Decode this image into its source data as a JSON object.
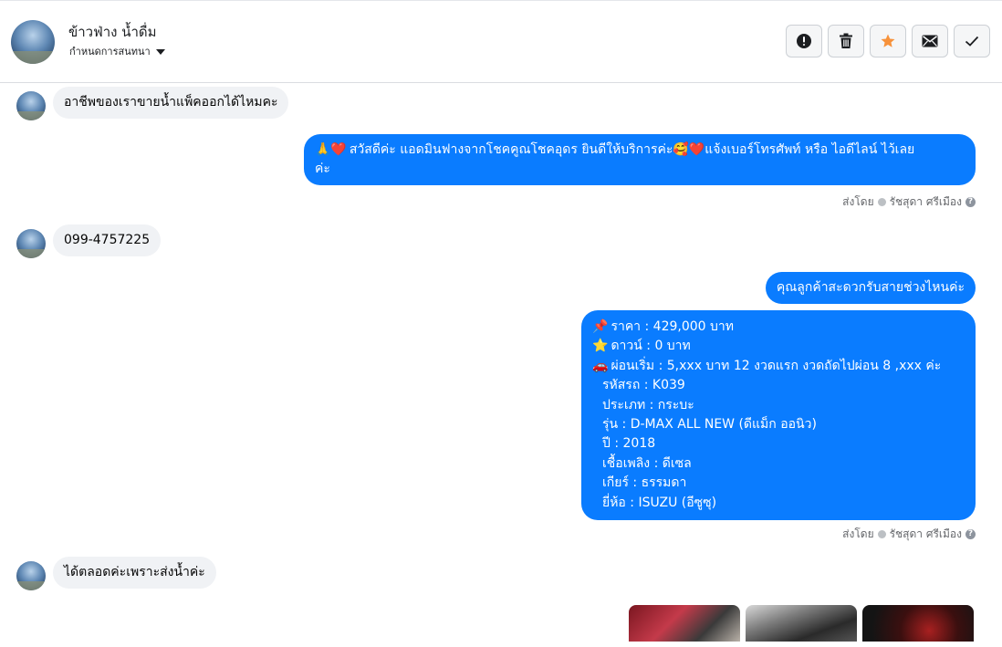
{
  "header": {
    "contact_name": "ข้าวฟ่าง น้ำดื่ม",
    "assign_label": "กำหนดการสนทนา"
  },
  "actions": [
    {
      "name": "spam-button",
      "icon": "alert-circle-icon"
    },
    {
      "name": "delete-button",
      "icon": "trash-icon"
    },
    {
      "name": "star-button",
      "icon": "star-icon",
      "color": "#f7923b"
    },
    {
      "name": "mark-unread-button",
      "icon": "envelope-icon"
    },
    {
      "name": "mark-done-button",
      "icon": "checkmark-icon"
    }
  ],
  "messages": {
    "m1": "อาชีพของเราขายน้ำแพ็คออกได้ไหมคะ",
    "m2_emoji": "🙏❤️",
    "m2_line1": "สวัสดีค่ะ แอดมินฟางจากโชคคูณโชคอุดร ยินดีให้บริการค่ะ🥰❤️แจ้งเบอร์โทรศัพท์ หรือ ไอดีไลน์  ไว้เลย",
    "m2_line2": "ค่ะ",
    "m3": "099-4757225",
    "m4": "คุณลูกค้าสะดวกรับสายช่วงไหนค่ะ",
    "m5": {
      "price": "ราคา : 429,000 บาท",
      "down": "ดาวน์ : 0 บาท",
      "installment": "ผ่อนเริ่ม : 5,xxx บาท 12 งวดแรก  งวดถัดไปผ่อน 8 ,xxx ค่ะ",
      "code": "รหัสรถ : K039",
      "type": "ประเภท : กระบะ",
      "model": "รุ่น : D-MAX ALL NEW (ดีแม็ก ออนิว)",
      "year": "ปี : 2018",
      "fuel": "เชื้อเพลิง : ดีเซล",
      "gear": "เกียร์ : ธรรมดา",
      "brand": "ยี่ห้อ : ISUZU (อีซูซุ)"
    },
    "m6": "ได้ตลอดค่ะเพราะส่งน้ำค่ะ"
  },
  "sent_by": {
    "prefix": "ส่งโดย",
    "name": "รัชสุดา ศรีเมือง",
    "help": "?"
  },
  "colors": {
    "outgoing": "#0a7cff",
    "incoming": "#f0f2f5",
    "star": "#f7923b"
  }
}
